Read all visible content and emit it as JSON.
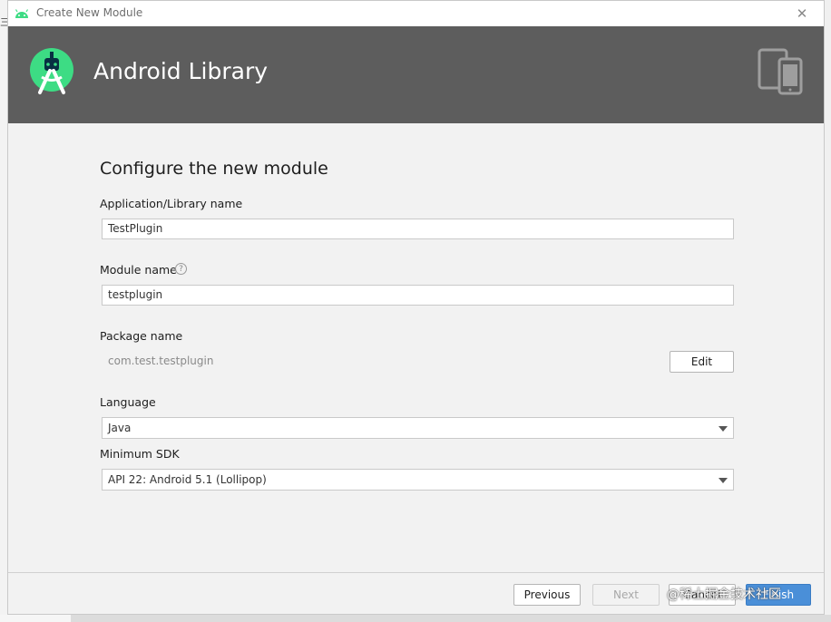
{
  "window": {
    "title": "Create New Module",
    "close_glyph": "✕",
    "icons": {
      "title_icon": "android-icon",
      "close": "close-icon"
    }
  },
  "header": {
    "title": "Android Library",
    "logo": "android-studio-logo-icon",
    "device_icon": "phone-tablet-icon",
    "background": "#5d5d5d"
  },
  "form": {
    "section_title": "Configure the new module",
    "app_name_label": "Application/Library name",
    "app_name_value": "TestPlugin",
    "module_name_label": "Module name",
    "module_name_help": "?",
    "module_name_value": "testplugin",
    "package_name_label": "Package name",
    "package_name_value": "com.test.testplugin",
    "edit_label": "Edit",
    "language_label": "Language",
    "language_value": "Java",
    "min_sdk_label": "Minimum SDK",
    "min_sdk_value": "API 22: Android 5.1 (Lollipop)"
  },
  "footer": {
    "previous_label": "Previous",
    "next_label": "Next",
    "cancel_label": "Cancel",
    "finish_label": "Finish",
    "accent_color": "#4a8fd8"
  },
  "watermark": "@稀土掘金技术社区",
  "background_glyph": "三"
}
